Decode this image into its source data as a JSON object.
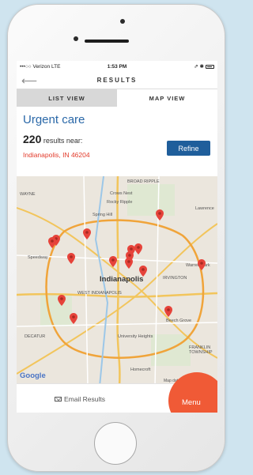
{
  "status_bar": {
    "carrier": "•••○○ Verizon  LTE",
    "time": "1:53 PM",
    "icons": "⇗ ✱"
  },
  "nav": {
    "back_icon": "back-arrow-icon",
    "title": "RESULTS"
  },
  "tabs": [
    {
      "label": "LIST VIEW",
      "active": false
    },
    {
      "label": "MAP VIEW",
      "active": true
    }
  ],
  "search": {
    "heading": "Urgent care",
    "count": "220",
    "count_suffix": "results near:",
    "location": "Indianapolis, IN 46204",
    "refine_label": "Refine"
  },
  "map": {
    "city_label": "Indianapolis",
    "labels": [
      "Crows Nest",
      "Rocky Ripple",
      "Spring Hill",
      "Speedway",
      "Warren Park",
      "Beech Grove",
      "University Heights",
      "Homecroft",
      "WEST INDIANAPOLIS",
      "IRVINGTON",
      "BROAD RIPPLE",
      "Lawrence",
      "FRANKLIN TOWNSHIP",
      "DECATUR",
      "WAYNE"
    ],
    "google": "Google",
    "attribution": "Map data ©2016 Go",
    "highway_shields": [
      "465",
      "70",
      "65",
      "465",
      "74",
      "65",
      "74",
      "465",
      "36"
    ],
    "marker_count": 13
  },
  "footer": {
    "email_label": "Email Results",
    "menu_label": "Menu"
  }
}
